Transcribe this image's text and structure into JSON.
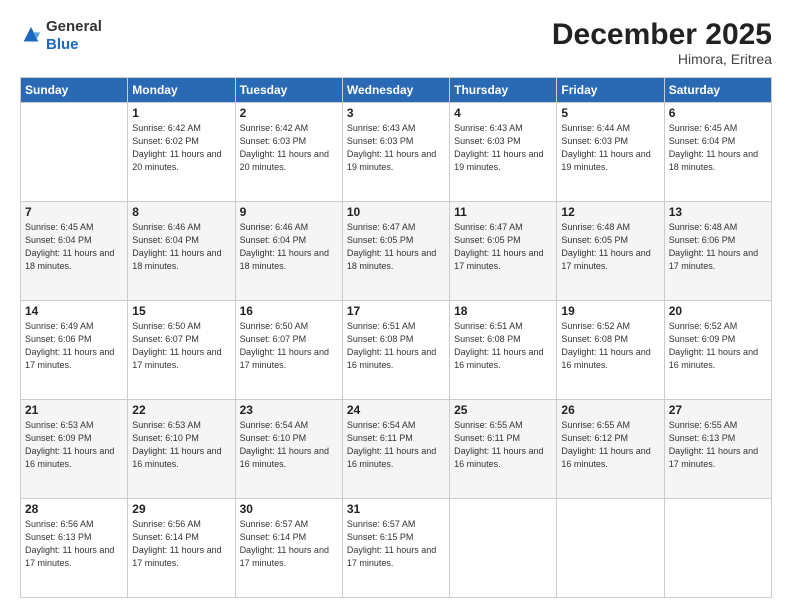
{
  "header": {
    "logo_general": "General",
    "logo_blue": "Blue",
    "month": "December 2025",
    "location": "Himora, Eritrea"
  },
  "weekdays": [
    "Sunday",
    "Monday",
    "Tuesday",
    "Wednesday",
    "Thursday",
    "Friday",
    "Saturday"
  ],
  "weeks": [
    [
      {
        "day": "",
        "info": ""
      },
      {
        "day": "1",
        "info": "Sunrise: 6:42 AM\nSunset: 6:02 PM\nDaylight: 11 hours\nand 20 minutes."
      },
      {
        "day": "2",
        "info": "Sunrise: 6:42 AM\nSunset: 6:03 PM\nDaylight: 11 hours\nand 20 minutes."
      },
      {
        "day": "3",
        "info": "Sunrise: 6:43 AM\nSunset: 6:03 PM\nDaylight: 11 hours\nand 19 minutes."
      },
      {
        "day": "4",
        "info": "Sunrise: 6:43 AM\nSunset: 6:03 PM\nDaylight: 11 hours\nand 19 minutes."
      },
      {
        "day": "5",
        "info": "Sunrise: 6:44 AM\nSunset: 6:03 PM\nDaylight: 11 hours\nand 19 minutes."
      },
      {
        "day": "6",
        "info": "Sunrise: 6:45 AM\nSunset: 6:04 PM\nDaylight: 11 hours\nand 18 minutes."
      }
    ],
    [
      {
        "day": "7",
        "info": "Sunrise: 6:45 AM\nSunset: 6:04 PM\nDaylight: 11 hours\nand 18 minutes."
      },
      {
        "day": "8",
        "info": "Sunrise: 6:46 AM\nSunset: 6:04 PM\nDaylight: 11 hours\nand 18 minutes."
      },
      {
        "day": "9",
        "info": "Sunrise: 6:46 AM\nSunset: 6:04 PM\nDaylight: 11 hours\nand 18 minutes."
      },
      {
        "day": "10",
        "info": "Sunrise: 6:47 AM\nSunset: 6:05 PM\nDaylight: 11 hours\nand 18 minutes."
      },
      {
        "day": "11",
        "info": "Sunrise: 6:47 AM\nSunset: 6:05 PM\nDaylight: 11 hours\nand 17 minutes."
      },
      {
        "day": "12",
        "info": "Sunrise: 6:48 AM\nSunset: 6:05 PM\nDaylight: 11 hours\nand 17 minutes."
      },
      {
        "day": "13",
        "info": "Sunrise: 6:48 AM\nSunset: 6:06 PM\nDaylight: 11 hours\nand 17 minutes."
      }
    ],
    [
      {
        "day": "14",
        "info": "Sunrise: 6:49 AM\nSunset: 6:06 PM\nDaylight: 11 hours\nand 17 minutes."
      },
      {
        "day": "15",
        "info": "Sunrise: 6:50 AM\nSunset: 6:07 PM\nDaylight: 11 hours\nand 17 minutes."
      },
      {
        "day": "16",
        "info": "Sunrise: 6:50 AM\nSunset: 6:07 PM\nDaylight: 11 hours\nand 17 minutes."
      },
      {
        "day": "17",
        "info": "Sunrise: 6:51 AM\nSunset: 6:08 PM\nDaylight: 11 hours\nand 16 minutes."
      },
      {
        "day": "18",
        "info": "Sunrise: 6:51 AM\nSunset: 6:08 PM\nDaylight: 11 hours\nand 16 minutes."
      },
      {
        "day": "19",
        "info": "Sunrise: 6:52 AM\nSunset: 6:08 PM\nDaylight: 11 hours\nand 16 minutes."
      },
      {
        "day": "20",
        "info": "Sunrise: 6:52 AM\nSunset: 6:09 PM\nDaylight: 11 hours\nand 16 minutes."
      }
    ],
    [
      {
        "day": "21",
        "info": "Sunrise: 6:53 AM\nSunset: 6:09 PM\nDaylight: 11 hours\nand 16 minutes."
      },
      {
        "day": "22",
        "info": "Sunrise: 6:53 AM\nSunset: 6:10 PM\nDaylight: 11 hours\nand 16 minutes."
      },
      {
        "day": "23",
        "info": "Sunrise: 6:54 AM\nSunset: 6:10 PM\nDaylight: 11 hours\nand 16 minutes."
      },
      {
        "day": "24",
        "info": "Sunrise: 6:54 AM\nSunset: 6:11 PM\nDaylight: 11 hours\nand 16 minutes."
      },
      {
        "day": "25",
        "info": "Sunrise: 6:55 AM\nSunset: 6:11 PM\nDaylight: 11 hours\nand 16 minutes."
      },
      {
        "day": "26",
        "info": "Sunrise: 6:55 AM\nSunset: 6:12 PM\nDaylight: 11 hours\nand 16 minutes."
      },
      {
        "day": "27",
        "info": "Sunrise: 6:55 AM\nSunset: 6:13 PM\nDaylight: 11 hours\nand 17 minutes."
      }
    ],
    [
      {
        "day": "28",
        "info": "Sunrise: 6:56 AM\nSunset: 6:13 PM\nDaylight: 11 hours\nand 17 minutes."
      },
      {
        "day": "29",
        "info": "Sunrise: 6:56 AM\nSunset: 6:14 PM\nDaylight: 11 hours\nand 17 minutes."
      },
      {
        "day": "30",
        "info": "Sunrise: 6:57 AM\nSunset: 6:14 PM\nDaylight: 11 hours\nand 17 minutes."
      },
      {
        "day": "31",
        "info": "Sunrise: 6:57 AM\nSunset: 6:15 PM\nDaylight: 11 hours\nand 17 minutes."
      },
      {
        "day": "",
        "info": ""
      },
      {
        "day": "",
        "info": ""
      },
      {
        "day": "",
        "info": ""
      }
    ]
  ]
}
